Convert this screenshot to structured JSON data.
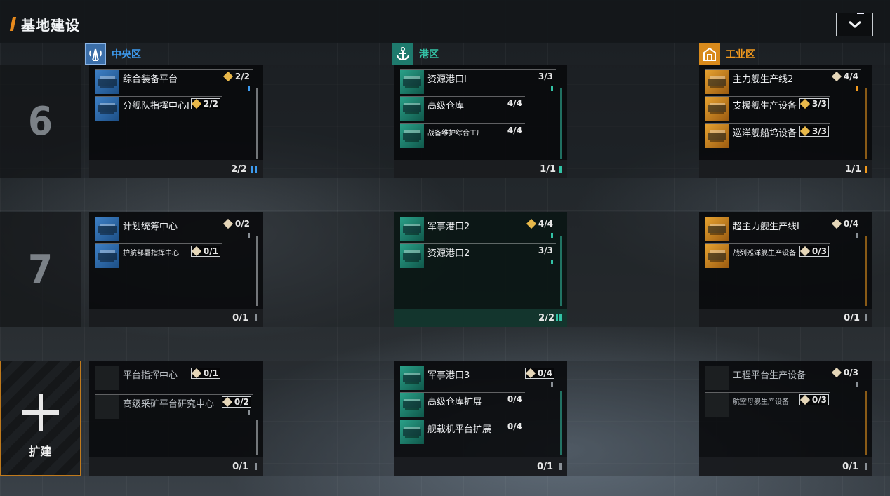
{
  "header": {
    "title": "基地建设",
    "collapse_icon": "chevron-down-icon"
  },
  "zones": {
    "central": {
      "name": "中央区",
      "icon": "signal-tower-icon",
      "color": "#3d9bf0"
    },
    "port": {
      "name": "港区",
      "icon": "anchor-icon",
      "color": "#33c3a6"
    },
    "industrial": {
      "name": "工业区",
      "icon": "factory-icon",
      "color": "#f29a1e"
    }
  },
  "levels": {
    "six": "6",
    "seven": "7",
    "expand_label": "扩建"
  },
  "rows": {
    "r6": {
      "central": {
        "count": "2/2",
        "buildings": [
          {
            "name": "综合装备平台",
            "level": "2/2"
          },
          {
            "name": "分舰队指挥中心I",
            "level": "2/2"
          }
        ]
      },
      "port": {
        "count": "1/1",
        "buildings": [
          {
            "name": "资源港口I",
            "level": "3/3"
          },
          {
            "name": "高级仓库",
            "level": "4/4"
          },
          {
            "name": "战备维护综合工厂",
            "level": "4/4"
          }
        ]
      },
      "industrial": {
        "count": "1/1",
        "buildings": [
          {
            "name": "主力舰生产线2",
            "level": "4/4"
          },
          {
            "name": "支援舰生产设备",
            "level": "3/3"
          },
          {
            "name": "巡洋舰船坞设备",
            "level": "3/3"
          }
        ]
      }
    },
    "r7": {
      "central": {
        "count": "0/1",
        "buildings": [
          {
            "name": "计划统筹中心",
            "level": "0/2"
          },
          {
            "name": "护航部署指挥中心",
            "level": "0/1"
          }
        ]
      },
      "port": {
        "count": "2/2",
        "buildings": [
          {
            "name": "军事港口2",
            "level": "4/4"
          },
          {
            "name": "资源港口2",
            "level": "3/3"
          }
        ]
      },
      "industrial": {
        "count": "0/1",
        "buildings": [
          {
            "name": "超主力舰生产线I",
            "level": "0/4"
          },
          {
            "name": "战列巡洋舰生产设备",
            "level": "0/3"
          }
        ]
      }
    },
    "r8": {
      "central": {
        "count": "0/1",
        "buildings": [
          {
            "name": "平台指挥中心",
            "level": "0/1"
          },
          {
            "name": "高级采矿平台研究中心",
            "level": "0/2"
          }
        ]
      },
      "port": {
        "count": "0/1",
        "buildings": [
          {
            "name": "军事港口3",
            "level": "0/4"
          },
          {
            "name": "高级仓库扩展",
            "level": "0/4"
          },
          {
            "name": "舰载机平台扩展",
            "level": "0/4"
          }
        ]
      },
      "industrial": {
        "count": "0/1",
        "buildings": [
          {
            "name": "工程平台生产设备",
            "level": "0/3"
          },
          {
            "name": "航空母舰生产设备",
            "level": "0/3"
          }
        ]
      }
    }
  }
}
